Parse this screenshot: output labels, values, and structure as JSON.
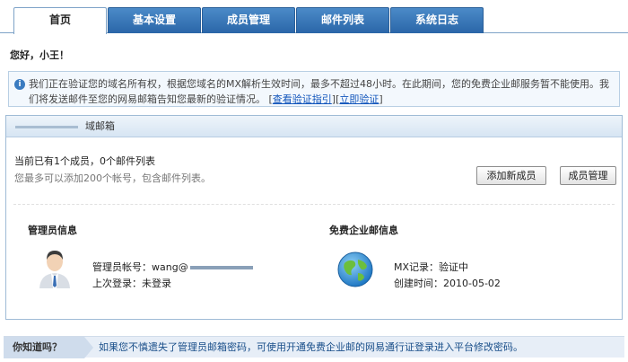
{
  "tabs": [
    "首页",
    "基本设置",
    "成员管理",
    "邮件列表",
    "系统日志"
  ],
  "greeting": "您好，小王！",
  "notice": {
    "text": "我们正在验证您的域名所有权，根据您域名的MX解析生效时间，最多不超过48小时。在此期间，您的免费企业邮服务暂不能使用。我们将发送邮件至您的网易邮箱告知您最新的验证情况。",
    "bracket_open": "[",
    "link_guide": "查看验证指引",
    "separator": "][",
    "link_verify": "立即验证",
    "bracket_close": "]"
  },
  "domain": {
    "title": "域邮箱",
    "stats_line1": "当前已有1个成员，0个邮件列表",
    "stats_line2": "您最多可以添加200个帐号，包含邮件列表。",
    "add_member_label": "添加新成员",
    "manage_members_label": "成员管理"
  },
  "admin": {
    "title": "管理员信息",
    "account_label": "管理员帐号：",
    "account_value": "wang@",
    "last_login_label": "上次登录：",
    "last_login_value": "未登录"
  },
  "enterprise": {
    "title": "免费企业邮信息",
    "mx_label": "MX记录：",
    "mx_value": "验证中",
    "created_label": "创建时间：",
    "created_value": "2010-05-02"
  },
  "tip": {
    "label": "你知道吗？",
    "text": "如果您不慎遗失了管理员邮箱密码，可使用开通免费企业邮的网易通行证登录进入平台修改密码。"
  }
}
